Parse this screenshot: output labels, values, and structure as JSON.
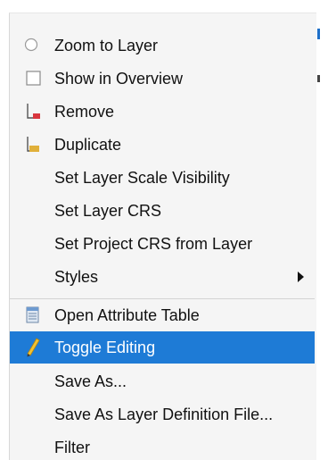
{
  "context_menu": {
    "items": [
      {
        "label": "Zoom to Layer",
        "icon": "zoom-icon"
      },
      {
        "label": "Show in Overview",
        "icon": "checkbox-icon"
      },
      {
        "label": "Remove",
        "icon": "remove-layer-icon"
      },
      {
        "label": "Duplicate",
        "icon": "duplicate-layer-icon"
      },
      {
        "label": "Set Layer Scale Visibility",
        "icon": ""
      },
      {
        "label": "Set Layer CRS",
        "icon": ""
      },
      {
        "label": "Set Project CRS from Layer",
        "icon": ""
      },
      {
        "label": "Styles",
        "icon": "",
        "has_submenu": true
      },
      {
        "label": "Open Attribute Table",
        "icon": "attribute-table-icon"
      },
      {
        "label": "Toggle Editing",
        "icon": "pencil-icon",
        "selected": true
      },
      {
        "label": "Save As...",
        "icon": ""
      },
      {
        "label": "Save As Layer Definition File...",
        "icon": ""
      },
      {
        "label": "Filter",
        "icon": ""
      }
    ]
  },
  "colors": {
    "selection": "#1e7bd6",
    "menu_background": "#f5f5f5",
    "remove_icon_accent": "#d9363e",
    "duplicate_icon_accent": "#e0b03a"
  }
}
